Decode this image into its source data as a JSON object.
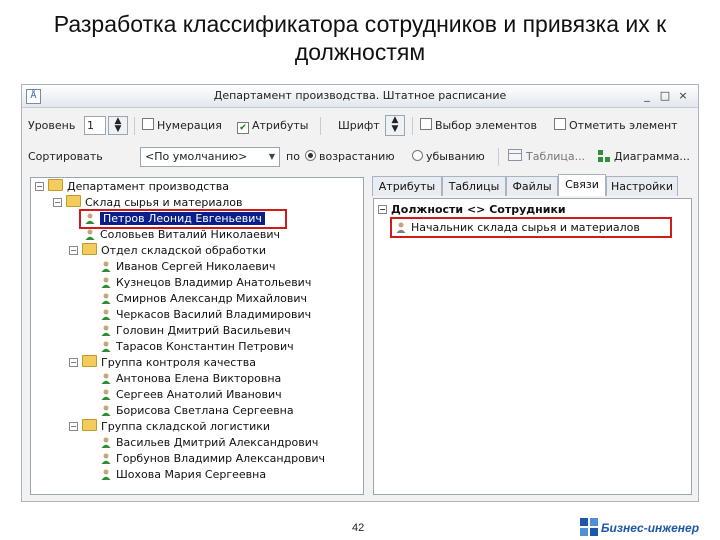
{
  "slide": {
    "title": "Разработка классификатора сотрудников и привязка их к должностям",
    "page_number": "42",
    "logo_text": "Бизнес-инженер"
  },
  "window": {
    "title": "Департамент производства. Штатное расписание",
    "controls": [
      "_",
      "□",
      "×"
    ]
  },
  "toolbar1": {
    "level_label": "Уровень",
    "level_value": "1",
    "numeration_label": "Нумерация",
    "numeration_checked": false,
    "attributes_label": "Атрибуты",
    "attributes_checked": true,
    "font_label": "Шрифт",
    "select_elements_label": "Выбор элементов",
    "mark_element_label": "Отметить элемент"
  },
  "toolbar2": {
    "sort_label": "Сортировать",
    "sort_value": "<По умолчанию>",
    "by_label": "по",
    "ascending_label": "возрастанию",
    "descending_label": "убыванию",
    "table_label": "Таблица...",
    "diagram_label": "Диаграмма..."
  },
  "tree": {
    "root": "Департамент производства",
    "warehouse": "Склад сырья и материалов",
    "selected_person": "Петров Леонид Евгеньевич",
    "person2": "Соловьев Виталий Николаевич",
    "group1": "Отдел складской обработки",
    "group1_people": [
      "Иванов Сергей Николаевич",
      "Кузнецов Владимир Анатольевич",
      "Смирнов Александр Михайлович",
      "Черкасов Василий Владимирович",
      "Головин Дмитрий Васильевич",
      "Тарасов Константин Петрович"
    ],
    "group2": "Группа контроля качества",
    "group2_people": [
      "Антонова Елена Викторовна",
      "Сергеев Анатолий Иванович",
      "Борисова Светлана Сергеевна"
    ],
    "group3": "Группа складской логистики",
    "group3_people": [
      "Васильев Дмитрий Александрович",
      "Горбунов Владимир Александрович",
      "Шохова Мария Сергеевна"
    ]
  },
  "tabs": [
    "Атрибуты",
    "Таблицы",
    "Файлы",
    "Связи",
    "Настройки"
  ],
  "active_tab": "Связи",
  "links_panel": {
    "header": "Должности <> Сотрудники",
    "item": "Начальник склада сырья и материалов"
  },
  "colors": {
    "selection": "#0a1f8a",
    "highlight": "#d11b1b",
    "logo": "#1d58a8"
  }
}
